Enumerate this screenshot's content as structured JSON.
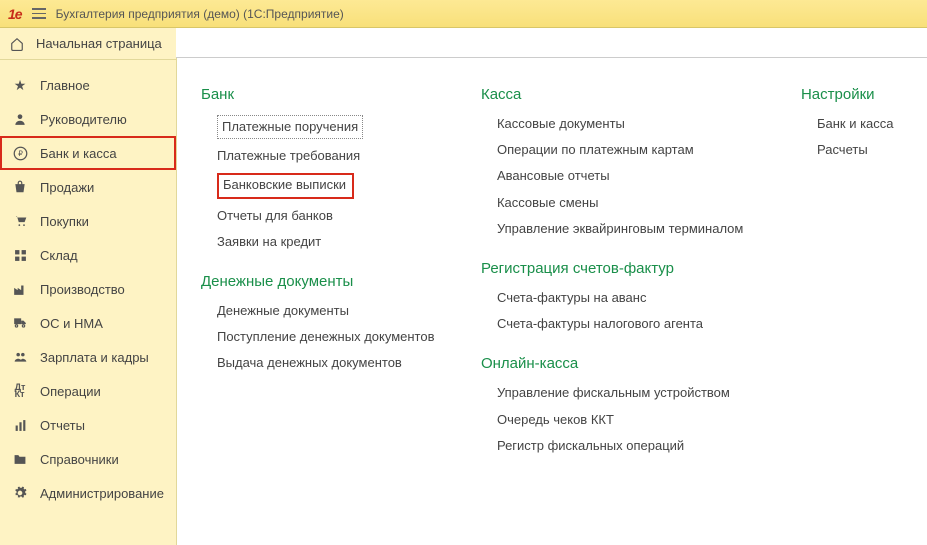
{
  "titlebar": {
    "logo_main": "1C",
    "logo_sub": "",
    "app_title": "Бухгалтерия предприятия (демо)  (1С:Предприятие)"
  },
  "home": {
    "label": "Начальная страница"
  },
  "nav": {
    "items": [
      {
        "label": "Главное"
      },
      {
        "label": "Руководителю"
      },
      {
        "label": "Банк и касса"
      },
      {
        "label": "Продажи"
      },
      {
        "label": "Покупки"
      },
      {
        "label": "Склад"
      },
      {
        "label": "Производство"
      },
      {
        "label": "ОС и НМА"
      },
      {
        "label": "Зарплата и кадры"
      },
      {
        "label": "Операции"
      },
      {
        "label": "Отчеты"
      },
      {
        "label": "Справочники"
      },
      {
        "label": "Администрирование"
      }
    ]
  },
  "content": {
    "col1": {
      "s1_title": "Банк",
      "s1_links": {
        "0": "Платежные поручения",
        "1": "Платежные требования",
        "2": "Банковские выписки",
        "3": "Отчеты для банков",
        "4": "Заявки на кредит"
      },
      "s2_title": "Денежные документы",
      "s2_links": {
        "0": "Денежные документы",
        "1": "Поступление денежных документов",
        "2": "Выдача денежных документов"
      }
    },
    "col2": {
      "s1_title": "Касса",
      "s1_links": {
        "0": "Кассовые документы",
        "1": "Операции по платежным картам",
        "2": "Авансовые отчеты",
        "3": "Кассовые смены",
        "4": "Управление эквайринговым терминалом"
      },
      "s2_title": "Регистрация счетов-фактур",
      "s2_links": {
        "0": "Счета-фактуры на аванс",
        "1": "Счета-фактуры налогового агента"
      },
      "s3_title": "Онлайн-касса",
      "s3_links": {
        "0": "Управление фискальным устройством",
        "1": "Очередь чеков ККТ",
        "2": "Регистр фискальных операций"
      }
    },
    "col3": {
      "s1_title": "Настройки",
      "s1_links": {
        "0": "Банк и касса",
        "1": "Расчеты"
      }
    }
  }
}
